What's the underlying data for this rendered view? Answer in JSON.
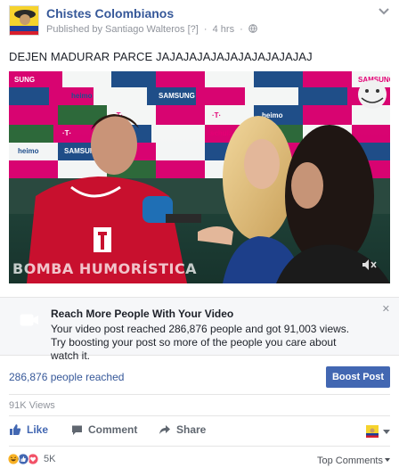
{
  "page": {
    "name": "Chistes Colombianos",
    "published_by": "Published by Santiago Walteros",
    "help_marker": "[?]",
    "time": "4 hrs"
  },
  "post": {
    "text": "DEJEN MADURAR PARCE JAJAJAJAJAJAJAJAJAJAJAJ"
  },
  "video": {
    "watermark": "BOMBA HUMORÍSTICA",
    "sponsor_texts": [
      "heimo24",
      "SAMSUNG",
      "schulz",
      "T··"
    ]
  },
  "reach_promo": {
    "title": "Reach More People With Your Video",
    "body": "Your video post reached 286,876 people and got 91,003 views. Try boosting your post so more of the people you care about watch it."
  },
  "stats": {
    "reached": "286,876 people reached",
    "boost_label": "Boost Post",
    "views": "91K Views"
  },
  "actions": {
    "like": "Like",
    "comment": "Comment",
    "share": "Share"
  },
  "reactions": {
    "count": "5K",
    "sort_label": "Top Comments"
  },
  "colors": {
    "link": "#365899",
    "boost": "#4267b2",
    "like": "#4267b2",
    "muted": "#90949c",
    "brand_magenta": "#e20074"
  }
}
